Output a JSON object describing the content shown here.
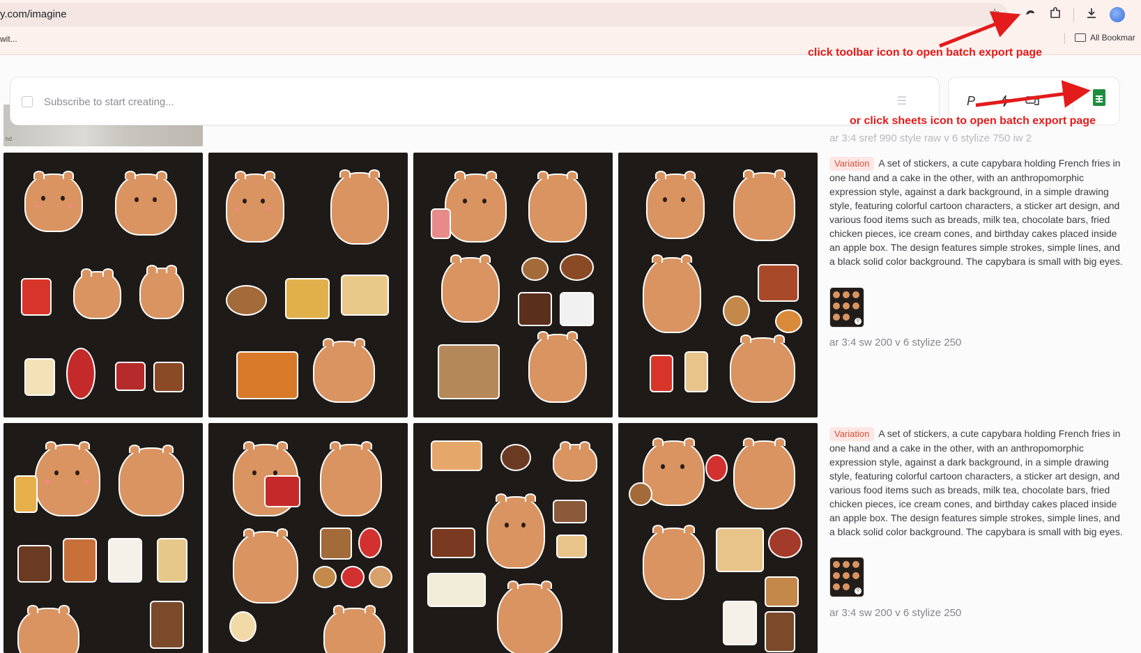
{
  "browser": {
    "url": "y.com/imagine",
    "bookmark_left": "wit...",
    "bookmark_right": "All Bookmar",
    "icons": [
      "star-icon",
      "extension-capture-icon",
      "puzzle-icon",
      "download-icon",
      "profile-avatar"
    ]
  },
  "prompt": {
    "placeholder": "Subscribe to start creating...",
    "mode_label": "P"
  },
  "faded_params": "ar 3:4 sref 990 style raw v 6 stylize 750 iw 2",
  "faded_thumb_text": "hd",
  "jobs": [
    {
      "badge": "Variation",
      "text": "A set of stickers, a cute capybara holding French fries in one hand and a cake in the other, with an anthropomorphic expression style, against a dark background, in a simple drawing style, featuring colorful cartoon characters, a sticker art design, and various food items such as breads, milk tea, chocolate bars, fried chicken pieces, ice cream cones, and birthday cakes placed inside an apple box. The design features simple strokes, simple lines, and a black solid color background. The capybara is small with big eyes.",
      "params": "ar 3:4 sw 200 v 6 stylize 250"
    },
    {
      "badge": "Variation",
      "text": "A set of stickers, a cute capybara holding French fries in one hand and a cake in the other, with an anthropomorphic expression style, against a dark background, in a simple drawing style, featuring colorful cartoon characters, a sticker art design, and various food items such as breads, milk tea, chocolate bars, fried chicken pieces, ice cream cones, and birthday cakes placed inside an apple box. The design features simple strokes, simple lines, and a black solid color background. The capybara is small with big eyes.",
      "params": "ar 3:4 sw 200 v 6 stylize 250"
    }
  ],
  "annotations": {
    "toolbar": "click toolbar icon to open batch export page",
    "sheets": "or click sheets icon to open batch export page"
  },
  "colors": {
    "annotation": "#e31b1b",
    "sheets_green": "#1e8e3e",
    "badge_bg": "#fde6e3",
    "badge_text": "#d4533d",
    "tile_bg": "#1e1a18",
    "capybara": "#d99461"
  }
}
